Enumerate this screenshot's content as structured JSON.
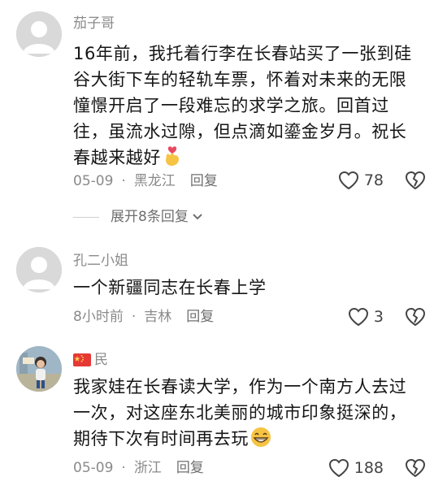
{
  "comments": [
    {
      "username": "茄子哥",
      "text": "16年前，我托着行李在长春站买了一张到硅谷大街下车的轻轨车票，怀着对未来的无限憧憬开启了一段难忘的求学之旅。回首过往，虽流水过隙，但点滴如鎏金岁月。祝长春越来越好",
      "date": "05-09",
      "location": "黑龙江",
      "reply_label": "回复",
      "likes": "78",
      "emoji": "finger-heart-emoji"
    },
    {
      "username": "孔二小姐",
      "text": "一个新疆同志在长春上学",
      "date": "8小时前",
      "location": "吉林",
      "reply_label": "回复",
      "likes": "3"
    },
    {
      "username": "民",
      "text": "我家娃在长春读大学，作为一个南方人去过一次，对这座东北美丽的城市印象挺深的，期待下次有时间再去玩",
      "date": "05-09",
      "location": "浙江",
      "reply_label": "回复",
      "likes": "188",
      "emoji": "grinning-emoji"
    }
  ],
  "expand_replies_label": "展开8条回复",
  "colors": {
    "text": "#161616",
    "meta": "#8a8a8a",
    "icon": "#444444"
  }
}
